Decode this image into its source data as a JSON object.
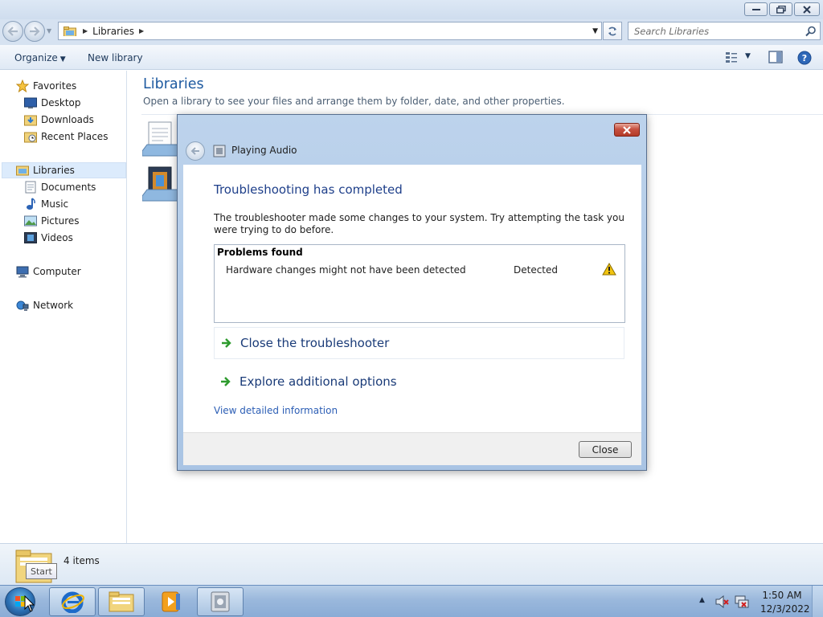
{
  "explorer": {
    "address": {
      "crumb": "Libraries"
    },
    "search": {
      "placeholder": "Search Libraries"
    },
    "toolbar": {
      "organize": "Organize",
      "new_library": "New library"
    },
    "sidebar": {
      "favorites": "Favorites",
      "desktop": "Desktop",
      "downloads": "Downloads",
      "recent_places": "Recent Places",
      "libraries": "Libraries",
      "documents": "Documents",
      "music": "Music",
      "pictures": "Pictures",
      "videos": "Videos",
      "computer": "Computer",
      "network": "Network"
    },
    "content": {
      "title": "Libraries",
      "subtitle": "Open a library to see your files and arrange them by folder, date, and other properties."
    },
    "status": {
      "count": "4 items"
    }
  },
  "tooltip": {
    "start": "Start"
  },
  "taskbar": {
    "time": "1:50 AM",
    "date": "12/3/2022"
  },
  "dialog": {
    "title": "Playing Audio",
    "heading": "Troubleshooting has completed",
    "description": "The troubleshooter made some changes to your system. Try attempting the task you were trying to do before.",
    "problems_header": "Problems found",
    "problem": {
      "name": "Hardware changes might not have been detected",
      "status": "Detected"
    },
    "close_troubleshooter": "Close the troubleshooter",
    "explore_options": "Explore additional options",
    "view_details": "View detailed information",
    "close_button": "Close"
  },
  "colors": {
    "heading_blue": "#1e3f8a",
    "link_blue": "#2c5eb5",
    "title_green_blue": "#1e5aa0",
    "arrow_green": "#2e9b2e",
    "warning_yellow": "#f2c40f"
  },
  "icons": {
    "back": "back-arrow-icon",
    "forward": "forward-arrow-icon",
    "search": "search-icon",
    "refresh": "refresh-icon",
    "warning": "warning-icon",
    "command_arrow": "green-arrow-icon"
  }
}
